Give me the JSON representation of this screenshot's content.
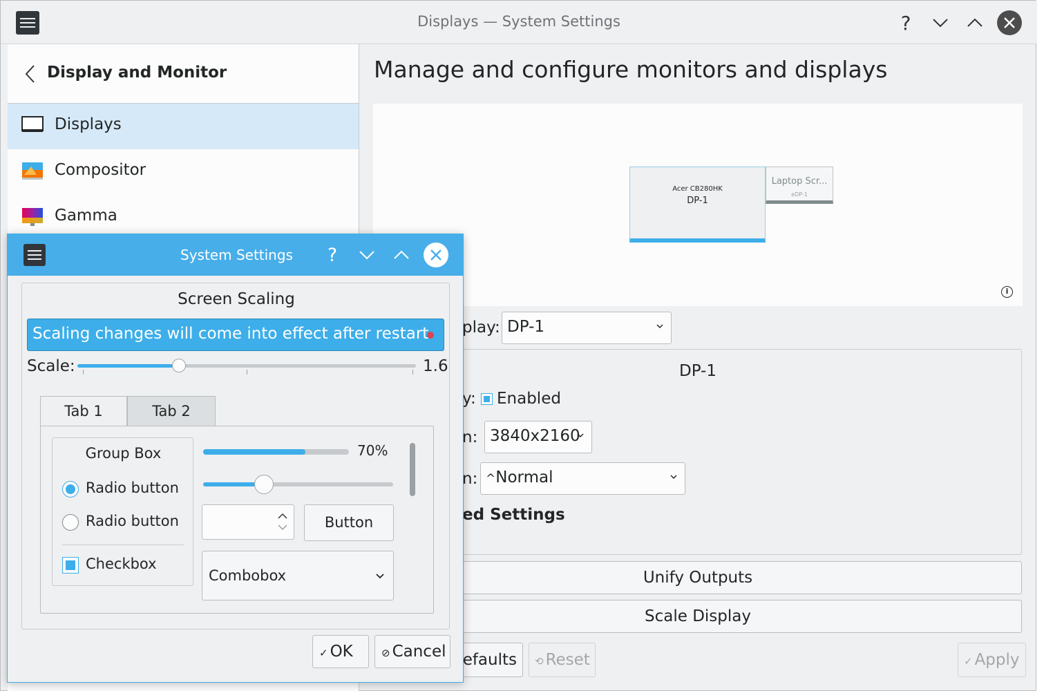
{
  "window": {
    "title": "Displays — System Settings",
    "help_glyph": "?",
    "minimize_glyph": "⌄",
    "maximize_glyph": "⌃",
    "close_glyph": "✕"
  },
  "sidebar": {
    "header": "Display and Monitor",
    "items": [
      {
        "label": "Displays",
        "icon": "display-icon",
        "active": true
      },
      {
        "label": "Compositor",
        "icon": "compositor-icon",
        "active": false
      },
      {
        "label": "Gamma",
        "icon": "gamma-icon",
        "active": false
      }
    ]
  },
  "content": {
    "heading": "Manage and configure monitors and displays",
    "monitors": [
      {
        "name": "Acer CB280HK",
        "port": "DP-1"
      },
      {
        "name": "Laptop Scr...",
        "port": "eDP-1"
      }
    ],
    "display_label": "play:",
    "display_value": "DP-1",
    "section_title": "DP-1",
    "enabled_label": "y:",
    "enabled_text": "Enabled",
    "resolution_label": "n:",
    "resolution_value": "3840x2160",
    "orientation_label": "n:",
    "orientation_glyph": "^",
    "orientation_value": "Normal",
    "advanced_label": "ed Settings",
    "unify_button": "Unify Outputs",
    "scale_button": "Scale Display",
    "defaults_button": "efaults",
    "reset_button": "Reset",
    "reset_glyph": "⟲",
    "apply_button": "Apply",
    "apply_glyph": "✓"
  },
  "dialog": {
    "title": "System Settings",
    "help_glyph": "?",
    "minimize_glyph": "⌄",
    "maximize_glyph": "⌃",
    "close_glyph": "✕",
    "section_title": "Screen Scaling",
    "banner": "Scaling changes will come into effect after restart",
    "scale_label": "Scale:",
    "scale_value": "1.6",
    "scale_fraction": 0.3,
    "tabs": [
      "Tab 1",
      "Tab 2"
    ],
    "group_box_title": "Group Box",
    "radio1": "Radio button",
    "radio2": "Radio button",
    "checkbox": "Checkbox",
    "progress_text": "70%",
    "progress_value": 0.7,
    "slider_value": 0.32,
    "button": "Button",
    "combobox": "Combobox",
    "ok": "OK",
    "ok_glyph": "✓",
    "cancel": "Cancel",
    "cancel_glyph": "⊘"
  },
  "colors": {
    "accent": "#3daee9",
    "titlebar_active": "#47aee9",
    "window_bg": "#eff0f1",
    "selection_bg": "#d6e9f8",
    "text": "#232627",
    "alert_dot": "#da4453"
  }
}
